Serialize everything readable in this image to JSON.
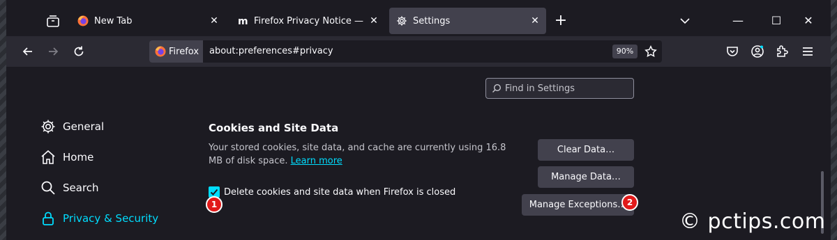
{
  "tabs": [
    {
      "title": "New Tab",
      "favicon": "firefox-icon",
      "selected": false
    },
    {
      "title": "Firefox Privacy Notice — Mozilla",
      "favicon": "mozilla-m-icon",
      "selected": false
    },
    {
      "title": "Settings",
      "favicon": "gear-icon",
      "selected": true
    }
  ],
  "toolbar": {
    "identity_label": "Firefox",
    "url": "about:preferences#privacy",
    "zoom": "90%"
  },
  "settings_search": {
    "placeholder": "Find in Settings"
  },
  "categories": [
    {
      "label": "General",
      "icon": "gear-icon"
    },
    {
      "label": "Home",
      "icon": "home-icon"
    },
    {
      "label": "Search",
      "icon": "search-icon"
    },
    {
      "label": "Privacy & Security",
      "icon": "lock-icon",
      "selected": true
    }
  ],
  "cookies": {
    "title": "Cookies and Site Data",
    "description": "Your stored cookies, site data, and cache are currently using 16.8 MB of disk space.",
    "learn_more": "Learn more",
    "clear_button": "Clear Data…",
    "manage_button": "Manage Data…",
    "exceptions_button": "Manage Exceptions…",
    "delete_checkbox_label": "Delete cookies and site data when Firefox is closed",
    "delete_checked": true
  },
  "annotations": {
    "badge1": "1",
    "badge2": "2"
  },
  "watermark": "© pctips.com",
  "colors": {
    "accent": "#00ddff",
    "badge": "#e11a1a"
  }
}
